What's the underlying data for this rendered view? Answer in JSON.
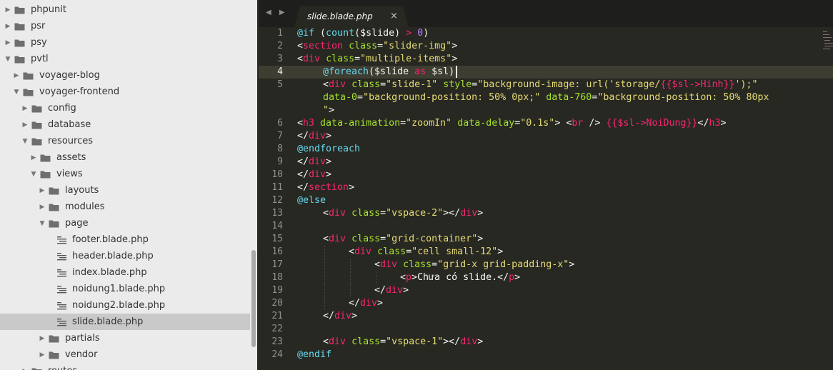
{
  "sidebar": {
    "items": [
      {
        "label": "phpunit",
        "type": "folder",
        "depth": 0,
        "expanded": false,
        "selected": false
      },
      {
        "label": "psr",
        "type": "folder",
        "depth": 0,
        "expanded": false,
        "selected": false
      },
      {
        "label": "psy",
        "type": "folder",
        "depth": 0,
        "expanded": false,
        "selected": false
      },
      {
        "label": "pvtl",
        "type": "folder",
        "depth": 0,
        "expanded": true,
        "selected": false
      },
      {
        "label": "voyager-blog",
        "type": "folder",
        "depth": 1,
        "expanded": false,
        "selected": false
      },
      {
        "label": "voyager-frontend",
        "type": "folder",
        "depth": 1,
        "expanded": true,
        "selected": false
      },
      {
        "label": "config",
        "type": "folder",
        "depth": 2,
        "expanded": false,
        "selected": false
      },
      {
        "label": "database",
        "type": "folder",
        "depth": 2,
        "expanded": false,
        "selected": false
      },
      {
        "label": "resources",
        "type": "folder",
        "depth": 2,
        "expanded": true,
        "selected": false
      },
      {
        "label": "assets",
        "type": "folder",
        "depth": 3,
        "expanded": false,
        "selected": false
      },
      {
        "label": "views",
        "type": "folder",
        "depth": 3,
        "expanded": true,
        "selected": false
      },
      {
        "label": "layouts",
        "type": "folder",
        "depth": 4,
        "expanded": false,
        "selected": false
      },
      {
        "label": "modules",
        "type": "folder",
        "depth": 4,
        "expanded": false,
        "selected": false
      },
      {
        "label": "page",
        "type": "folder",
        "depth": 4,
        "expanded": true,
        "selected": false
      },
      {
        "label": "footer.blade.php",
        "type": "file",
        "depth": 5,
        "expanded": false,
        "selected": false
      },
      {
        "label": "header.blade.php",
        "type": "file",
        "depth": 5,
        "expanded": false,
        "selected": false
      },
      {
        "label": "index.blade.php",
        "type": "file",
        "depth": 5,
        "expanded": false,
        "selected": false
      },
      {
        "label": "noidung1.blade.php",
        "type": "file",
        "depth": 5,
        "expanded": false,
        "selected": false
      },
      {
        "label": "noidung2.blade.php",
        "type": "file",
        "depth": 5,
        "expanded": false,
        "selected": false
      },
      {
        "label": "slide.blade.php",
        "type": "file",
        "depth": 5,
        "expanded": false,
        "selected": true
      },
      {
        "label": "partials",
        "type": "folder",
        "depth": 4,
        "expanded": false,
        "selected": false
      },
      {
        "label": "vendor",
        "type": "folder",
        "depth": 4,
        "expanded": false,
        "selected": false
      },
      {
        "label": "routes",
        "type": "folder",
        "depth": 2,
        "expanded": false,
        "selected": false
      }
    ]
  },
  "tabs": {
    "nav_arrows": "◀ ▶",
    "active_title": "slide.blade.php",
    "close_glyph": "×"
  },
  "editor": {
    "active_line": 4,
    "lines": [
      {
        "num": "1",
        "indent": 0,
        "tokens": [
          [
            "at",
            "@if"
          ],
          [
            "txt",
            " ("
          ],
          [
            "fn",
            "count"
          ],
          [
            "txt",
            "($slide) "
          ],
          [
            "kw",
            ">"
          ],
          [
            "txt",
            " "
          ],
          [
            "num",
            "0"
          ],
          [
            "txt",
            ")"
          ]
        ]
      },
      {
        "num": "2",
        "indent": 0,
        "tokens": [
          [
            "txt",
            "<"
          ],
          [
            "kw",
            "section"
          ],
          [
            "txt",
            " "
          ],
          [
            "attr",
            "class"
          ],
          [
            "txt",
            "="
          ],
          [
            "str",
            "\"slider-img\""
          ],
          [
            "txt",
            ">"
          ]
        ]
      },
      {
        "num": "3",
        "indent": 0,
        "tokens": [
          [
            "txt",
            "<"
          ],
          [
            "kw",
            "div"
          ],
          [
            "txt",
            " "
          ],
          [
            "attr",
            "class"
          ],
          [
            "txt",
            "="
          ],
          [
            "str",
            "\"multiple-items\""
          ],
          [
            "txt",
            ">"
          ]
        ]
      },
      {
        "num": "4",
        "indent": 1,
        "tokens": [
          [
            "at",
            "@foreach"
          ],
          [
            "txt",
            "($slide "
          ],
          [
            "kw",
            "as"
          ],
          [
            "txt",
            " $sl)"
          ]
        ]
      },
      {
        "num": "5",
        "indent": 1,
        "tokens": [
          [
            "txt",
            "<"
          ],
          [
            "kw",
            "div"
          ],
          [
            "txt",
            " "
          ],
          [
            "attr",
            "class"
          ],
          [
            "txt",
            "="
          ],
          [
            "str",
            "\"slide-1\""
          ],
          [
            "txt",
            " "
          ],
          [
            "attr",
            "style"
          ],
          [
            "txt",
            "="
          ],
          [
            "str",
            "\"background-image: url('storage/"
          ],
          [
            "kw",
            "{{$sl->Hinh}}"
          ],
          [
            "str",
            "');\""
          ]
        ]
      },
      {
        "num": "",
        "indent": 1,
        "tokens": [
          [
            "attr",
            "data-0"
          ],
          [
            "txt",
            "="
          ],
          [
            "str",
            "\"background-position: 50% 0px;\""
          ],
          [
            "txt",
            " "
          ],
          [
            "attr",
            "data-760"
          ],
          [
            "txt",
            "="
          ],
          [
            "str",
            "\"background-position: 50% 80px"
          ]
        ]
      },
      {
        "num": "",
        "indent": 1,
        "tokens": [
          [
            "str",
            "\""
          ],
          [
            "txt",
            ">"
          ]
        ]
      },
      {
        "num": "6",
        "indent": 0,
        "tokens": [
          [
            "txt",
            "<"
          ],
          [
            "kw",
            "h3"
          ],
          [
            "txt",
            " "
          ],
          [
            "attr",
            "data-animation"
          ],
          [
            "txt",
            "="
          ],
          [
            "str",
            "\"zoomIn\""
          ],
          [
            "txt",
            " "
          ],
          [
            "attr",
            "data-delay"
          ],
          [
            "txt",
            "="
          ],
          [
            "str",
            "\"0.1s\""
          ],
          [
            "txt",
            "> <"
          ],
          [
            "kw",
            "br"
          ],
          [
            "txt",
            " /> "
          ],
          [
            "kw",
            "{{$sl->NoiDung}}"
          ],
          [
            "txt",
            "</"
          ],
          [
            "kw",
            "h3"
          ],
          [
            "txt",
            ">"
          ]
        ]
      },
      {
        "num": "7",
        "indent": 0,
        "tokens": [
          [
            "txt",
            "</"
          ],
          [
            "kw",
            "div"
          ],
          [
            "txt",
            ">"
          ]
        ]
      },
      {
        "num": "8",
        "indent": 0,
        "tokens": [
          [
            "at",
            "@endforeach"
          ]
        ]
      },
      {
        "num": "9",
        "indent": 0,
        "tokens": [
          [
            "txt",
            "</"
          ],
          [
            "kw",
            "div"
          ],
          [
            "txt",
            ">"
          ]
        ]
      },
      {
        "num": "10",
        "indent": 0,
        "tokens": [
          [
            "txt",
            "</"
          ],
          [
            "kw",
            "div"
          ],
          [
            "txt",
            ">"
          ]
        ]
      },
      {
        "num": "11",
        "indent": 0,
        "tokens": [
          [
            "txt",
            "</"
          ],
          [
            "kw",
            "section"
          ],
          [
            "txt",
            ">"
          ]
        ]
      },
      {
        "num": "12",
        "indent": 0,
        "tokens": [
          [
            "at",
            "@else"
          ]
        ]
      },
      {
        "num": "13",
        "indent": 1,
        "tokens": [
          [
            "txt",
            "<"
          ],
          [
            "kw",
            "div"
          ],
          [
            "txt",
            " "
          ],
          [
            "attr",
            "class"
          ],
          [
            "txt",
            "="
          ],
          [
            "str",
            "\"vspace-2\""
          ],
          [
            "txt",
            "></"
          ],
          [
            "kw",
            "div"
          ],
          [
            "txt",
            ">"
          ]
        ]
      },
      {
        "num": "14",
        "indent": 0,
        "tokens": []
      },
      {
        "num": "15",
        "indent": 1,
        "tokens": [
          [
            "txt",
            "<"
          ],
          [
            "kw",
            "div"
          ],
          [
            "txt",
            " "
          ],
          [
            "attr",
            "class"
          ],
          [
            "txt",
            "="
          ],
          [
            "str",
            "\"grid-container\""
          ],
          [
            "txt",
            ">"
          ]
        ]
      },
      {
        "num": "16",
        "indent": 2,
        "tokens": [
          [
            "txt",
            "<"
          ],
          [
            "kw",
            "div"
          ],
          [
            "txt",
            " "
          ],
          [
            "attr",
            "class"
          ],
          [
            "txt",
            "="
          ],
          [
            "str",
            "\"cell small-12\""
          ],
          [
            "txt",
            ">"
          ]
        ]
      },
      {
        "num": "17",
        "indent": 3,
        "tokens": [
          [
            "txt",
            "<"
          ],
          [
            "kw",
            "div"
          ],
          [
            "txt",
            " "
          ],
          [
            "attr",
            "class"
          ],
          [
            "txt",
            "="
          ],
          [
            "str",
            "\"grid-x grid-padding-x\""
          ],
          [
            "txt",
            ">"
          ]
        ]
      },
      {
        "num": "18",
        "indent": 4,
        "tokens": [
          [
            "txt",
            "<"
          ],
          [
            "kw",
            "p"
          ],
          [
            "txt",
            ">Chưa có slide.</"
          ],
          [
            "kw",
            "p"
          ],
          [
            "txt",
            ">"
          ]
        ]
      },
      {
        "num": "19",
        "indent": 3,
        "tokens": [
          [
            "txt",
            "</"
          ],
          [
            "kw",
            "div"
          ],
          [
            "txt",
            ">"
          ]
        ]
      },
      {
        "num": "20",
        "indent": 2,
        "tokens": [
          [
            "txt",
            "</"
          ],
          [
            "kw",
            "div"
          ],
          [
            "txt",
            ">"
          ]
        ]
      },
      {
        "num": "21",
        "indent": 1,
        "tokens": [
          [
            "txt",
            "</"
          ],
          [
            "kw",
            "div"
          ],
          [
            "txt",
            ">"
          ]
        ]
      },
      {
        "num": "22",
        "indent": 0,
        "tokens": []
      },
      {
        "num": "23",
        "indent": 1,
        "tokens": [
          [
            "txt",
            "<"
          ],
          [
            "kw",
            "div"
          ],
          [
            "txt",
            " "
          ],
          [
            "attr",
            "class"
          ],
          [
            "txt",
            "="
          ],
          [
            "str",
            "\"vspace-1\""
          ],
          [
            "txt",
            "></"
          ],
          [
            "kw",
            "div"
          ],
          [
            "txt",
            ">"
          ]
        ]
      },
      {
        "num": "24",
        "indent": 0,
        "tokens": [
          [
            "at",
            "@endif"
          ]
        ]
      }
    ]
  },
  "colors": {
    "editor_bg": "#272822",
    "sidebar_bg": "#ebebeb",
    "selected_row": "#c9c9c9",
    "keyword": "#f92672",
    "attribute": "#a6e22e",
    "string": "#e6db74",
    "number": "#ae81ff",
    "function": "#66d9ef"
  }
}
